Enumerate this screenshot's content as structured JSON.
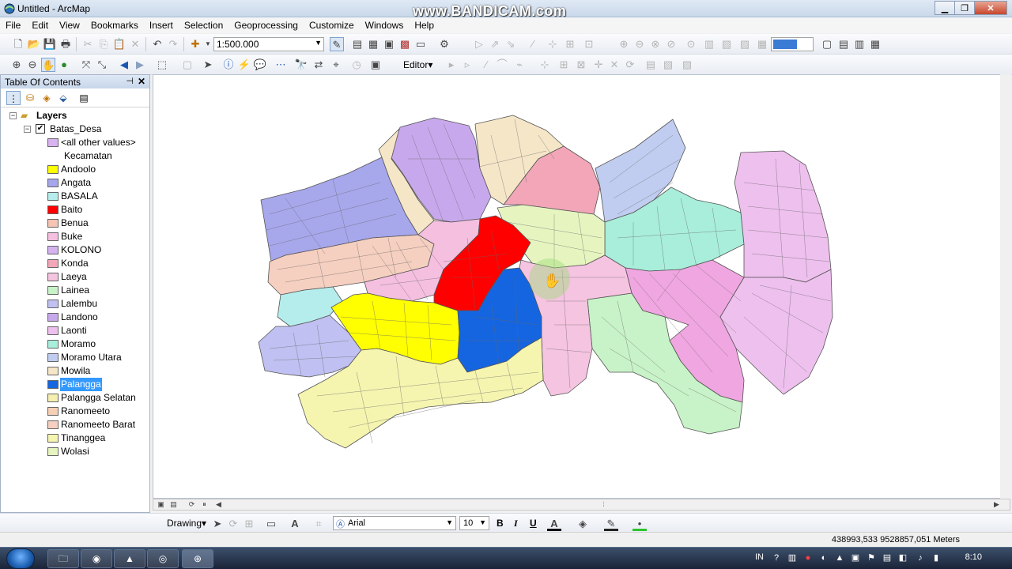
{
  "window": {
    "title": "Untitled - ArcMap",
    "watermark": "www.BANDICAM.com",
    "minimize": "▁",
    "restore": "❐",
    "close": "✕"
  },
  "menu": [
    "File",
    "Edit",
    "View",
    "Bookmarks",
    "Insert",
    "Selection",
    "Geoprocessing",
    "Customize",
    "Windows",
    "Help"
  ],
  "toolbar": {
    "scale": "1:500.000",
    "editor_label": "Editor▾"
  },
  "toc": {
    "title": "Table Of Contents",
    "pin": "⊣",
    "close": "✕",
    "root": "Layers",
    "layer": "Batas_Desa",
    "field": "Kecamatan",
    "legend": [
      {
        "label": "<all other values>",
        "color": "#d9b3f0"
      },
      {
        "label": "Andoolo",
        "color": "#ffff00"
      },
      {
        "label": "Angata",
        "color": "#a7a7ec"
      },
      {
        "label": "BASALA",
        "color": "#b5ecec"
      },
      {
        "label": "Baito",
        "color": "#ff0000"
      },
      {
        "label": "Benua",
        "color": "#f5c4b2"
      },
      {
        "label": "Buke",
        "color": "#f5bfe0"
      },
      {
        "label": "KOLONO",
        "color": "#d5b3f0"
      },
      {
        "label": "Konda",
        "color": "#f2a6b8"
      },
      {
        "label": "Laeya",
        "color": "#f5c4e0"
      },
      {
        "label": "Lainea",
        "color": "#c8f2c8"
      },
      {
        "label": "Lalembu",
        "color": "#c0c0f2"
      },
      {
        "label": "Landono",
        "color": "#c8a8ec"
      },
      {
        "label": "Laonti",
        "color": "#eec0ee"
      },
      {
        "label": "Moramo",
        "color": "#a8eeda"
      },
      {
        "label": "Moramo Utara",
        "color": "#c0cdf0"
      },
      {
        "label": "Mowila",
        "color": "#f5e6c8"
      },
      {
        "label": "Palangga",
        "color": "#1565e0"
      },
      {
        "label": "Palangga Selatan",
        "color": "#f5f0b0"
      },
      {
        "label": "Ranomeeto",
        "color": "#f5d0b5"
      },
      {
        "label": "Ranomeeto Barat",
        "color": "#f5cfc0"
      },
      {
        "label": "Tinanggea",
        "color": "#f5f5b0"
      },
      {
        "label": "Wolasi",
        "color": "#e6f5c0"
      }
    ],
    "selected_label": "Palangga"
  },
  "drawing": {
    "label": "Drawing▾",
    "font": "Arial",
    "size": "10",
    "bold": "B",
    "italic": "I",
    "underline": "U"
  },
  "status": {
    "coordinates": "438993,533  9528857,051 Meters"
  },
  "taskbar": {
    "lang": "IN",
    "time": "8:10"
  },
  "map_colors": {
    "purple": "#c8a8ec",
    "lavender": "#a7a7ec",
    "cream": "#f5e6c8",
    "peach": "#f5c4b2",
    "pink": "#f5bfe0",
    "rose": "#f2a6b8",
    "lightgreen": "#e6f5c0",
    "mint": "#a8eeda",
    "periwinkle": "#c0cdf0",
    "magenta": "#f0a6e0",
    "violet": "#eec0ee",
    "yellow": "#ffff00",
    "red": "#ff0000",
    "blue": "#1565e0",
    "paleyellow": "#f5f5b0",
    "cyan": "#b5ecec",
    "seafoam": "#c8f2c8"
  }
}
